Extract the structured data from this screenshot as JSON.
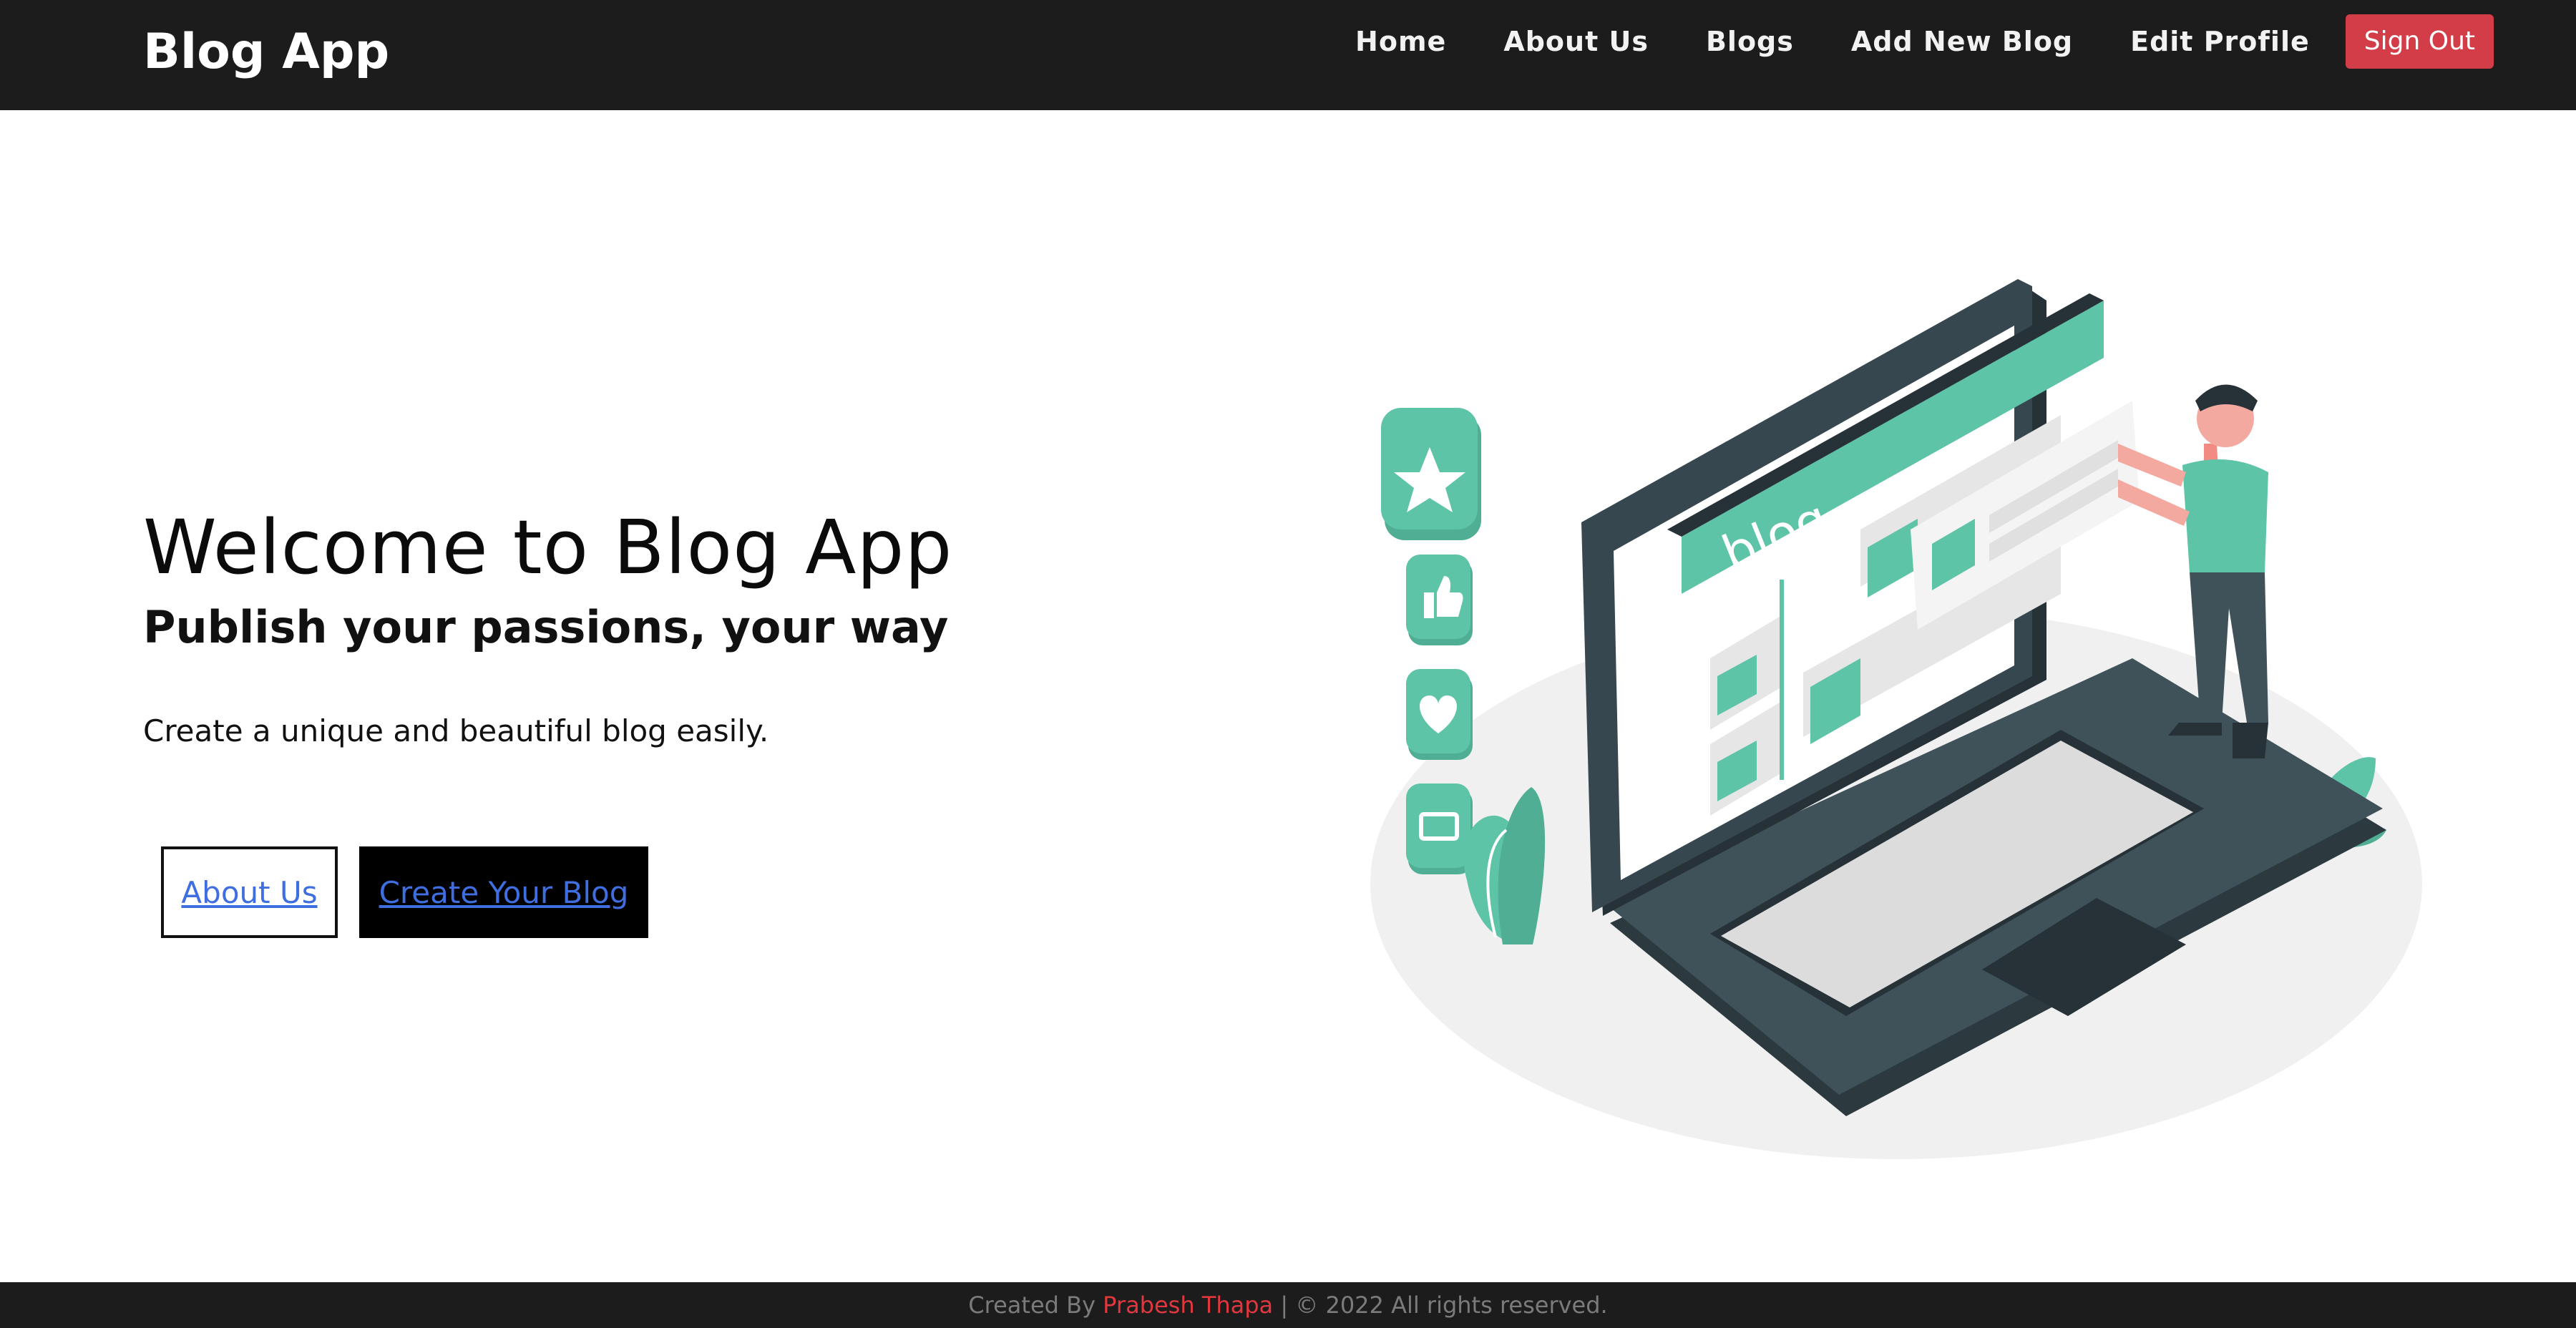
{
  "navbar": {
    "brand": "Blog App",
    "links": [
      {
        "label": "Home"
      },
      {
        "label": "About Us"
      },
      {
        "label": "Blogs"
      },
      {
        "label": "Add New Blog"
      },
      {
        "label": "Edit Profile"
      }
    ],
    "signout_label": "Sign Out"
  },
  "hero": {
    "title": "Welcome to Blog App",
    "subtitle": "Publish your passions, your way",
    "description": "Create a unique and beautiful blog easily.",
    "buttons": {
      "about_label": "About Us",
      "create_label": "Create Your Blog"
    }
  },
  "illustration": {
    "screen_word": "blog"
  },
  "footer": {
    "prefix": "Created By",
    "author": "Prabesh Thapa",
    "suffix": "| © 2022 All rights reserved."
  },
  "colors": {
    "nav_bg": "#1c1c1c",
    "signout": "#d23d47",
    "accent_green": "#5ec4a8",
    "laptop_dark": "#37474f",
    "link_blue": "#3f6ee0",
    "footer_author": "#e0383e"
  }
}
